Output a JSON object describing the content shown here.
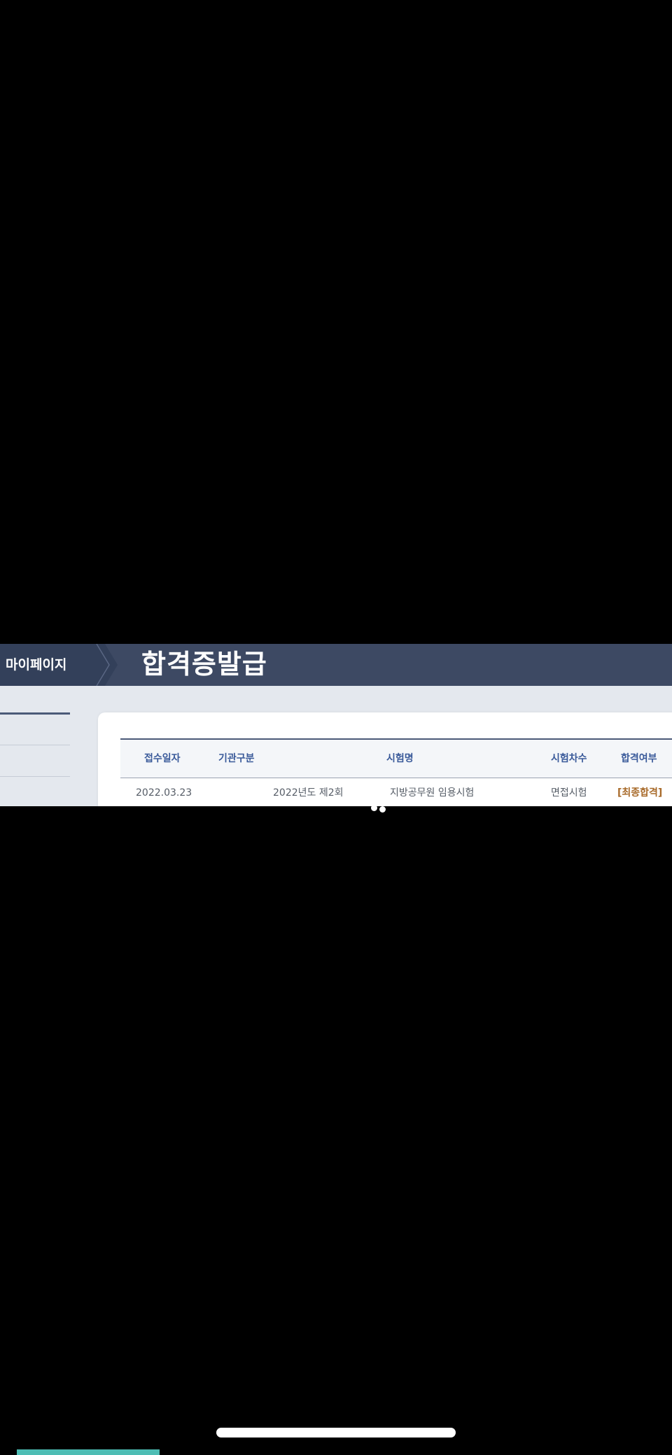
{
  "header": {
    "breadcrumb": "마이페이지",
    "title": "합격증발급"
  },
  "table": {
    "columns": [
      "접수일자",
      "기관구분",
      "시험명",
      "시험차수",
      "합격여부"
    ],
    "rows": [
      {
        "date": "2022.03.23",
        "exam_round_name": "2022년도 제2회",
        "exam_name": "지방공무원 임용시험",
        "session": "면접시험",
        "result": "[최종합격]"
      }
    ]
  },
  "colors": {
    "header_bar": "#3d4963",
    "column_header_text": "#3a5a9a",
    "result_text": "#a86a2a",
    "accent_bar": "#4dbdb4"
  }
}
